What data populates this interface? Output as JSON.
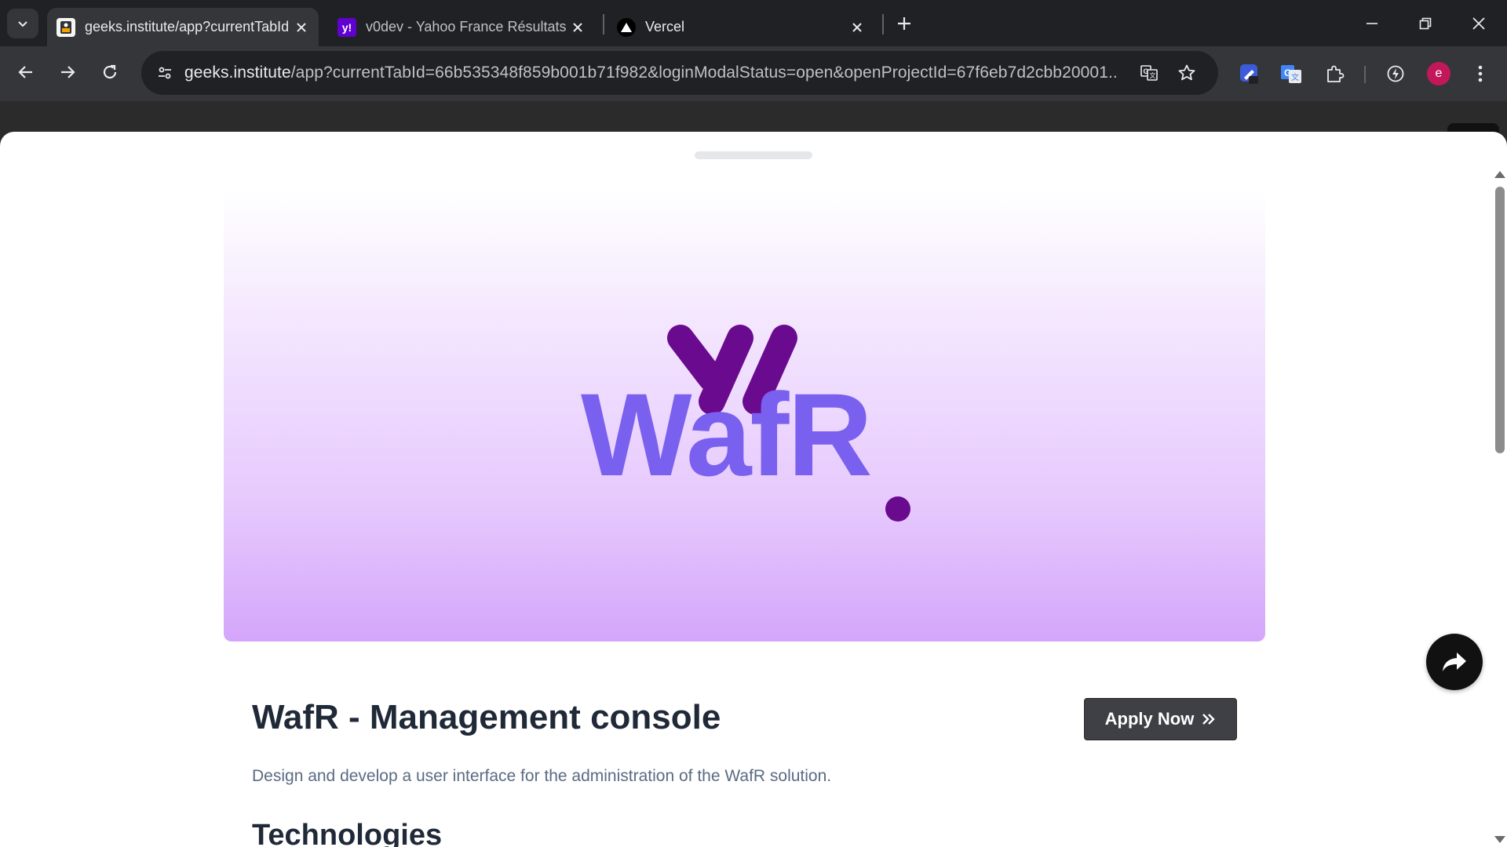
{
  "browser": {
    "tabs": [
      {
        "title": "geeks.institute/app?currentTabId",
        "active": true,
        "favicon": "geeks-institute-favicon"
      },
      {
        "title": "v0dev - Yahoo France Résultats",
        "active": false,
        "favicon": "yahoo-favicon"
      },
      {
        "title": "Vercel",
        "active": false,
        "favicon": "vercel-favicon"
      }
    ],
    "url_host": "geeks.institute",
    "url_rest": "/app?currentTabId=66b535348f859b001b71f982&loginModalStatus=open&openProjectId=67f6eb7d2cbb20001...",
    "profile_initial": "e",
    "colors": {
      "frame": "#202124",
      "toolbar": "#35363a",
      "avatar": "#c2185b"
    }
  },
  "modal": {
    "hero_logo_text": "WafR",
    "hero_colors": {
      "mark": "#6a0a8f",
      "wordmark": "#7a60ee",
      "gradient_end": "#d4a6fb"
    },
    "title": "WafR - Management console",
    "apply_label": "Apply Now",
    "description": "Design and develop a user interface for the administration of the WafR solution.",
    "section_heading": "Technologies"
  }
}
